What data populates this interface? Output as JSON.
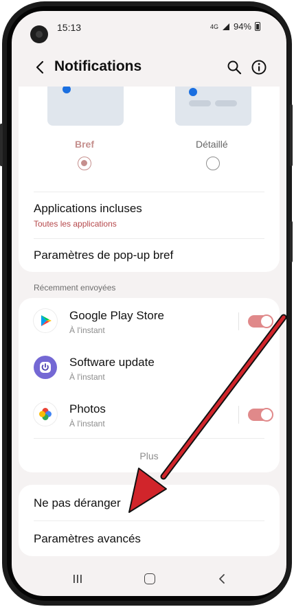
{
  "status_bar": {
    "time": "15:13",
    "network": "4G",
    "battery": "94%"
  },
  "header": {
    "title": "Notifications"
  },
  "popup_style": {
    "options": [
      {
        "label": "Bref",
        "selected": true
      },
      {
        "label": "Détaillé",
        "selected": false
      }
    ],
    "selected_color": "#c58f8d"
  },
  "settings": {
    "included_apps": {
      "title": "Applications incluses",
      "subtitle": "Toutes les applications"
    },
    "brief_popup": {
      "title": "Paramètres de pop-up bref"
    }
  },
  "recent": {
    "section_label": "Récemment envoyées",
    "apps": [
      {
        "name": "Google Play Store",
        "time": "À l'instant",
        "icon": "google-play-icon",
        "has_toggle": true,
        "enabled": true
      },
      {
        "name": "Software update",
        "time": "À l'instant",
        "icon": "software-update-icon",
        "has_toggle": false
      },
      {
        "name": "Photos",
        "time": "À l'instant",
        "icon": "google-photos-icon",
        "has_toggle": true,
        "enabled": true
      }
    ],
    "more_label": "Plus"
  },
  "bottom": {
    "dnd": "Ne pas déranger",
    "advanced": "Paramètres avancés"
  },
  "colors": {
    "accent": "#e0898a",
    "subtitle_red": "#b5474a",
    "arrow": "#d1252b"
  }
}
